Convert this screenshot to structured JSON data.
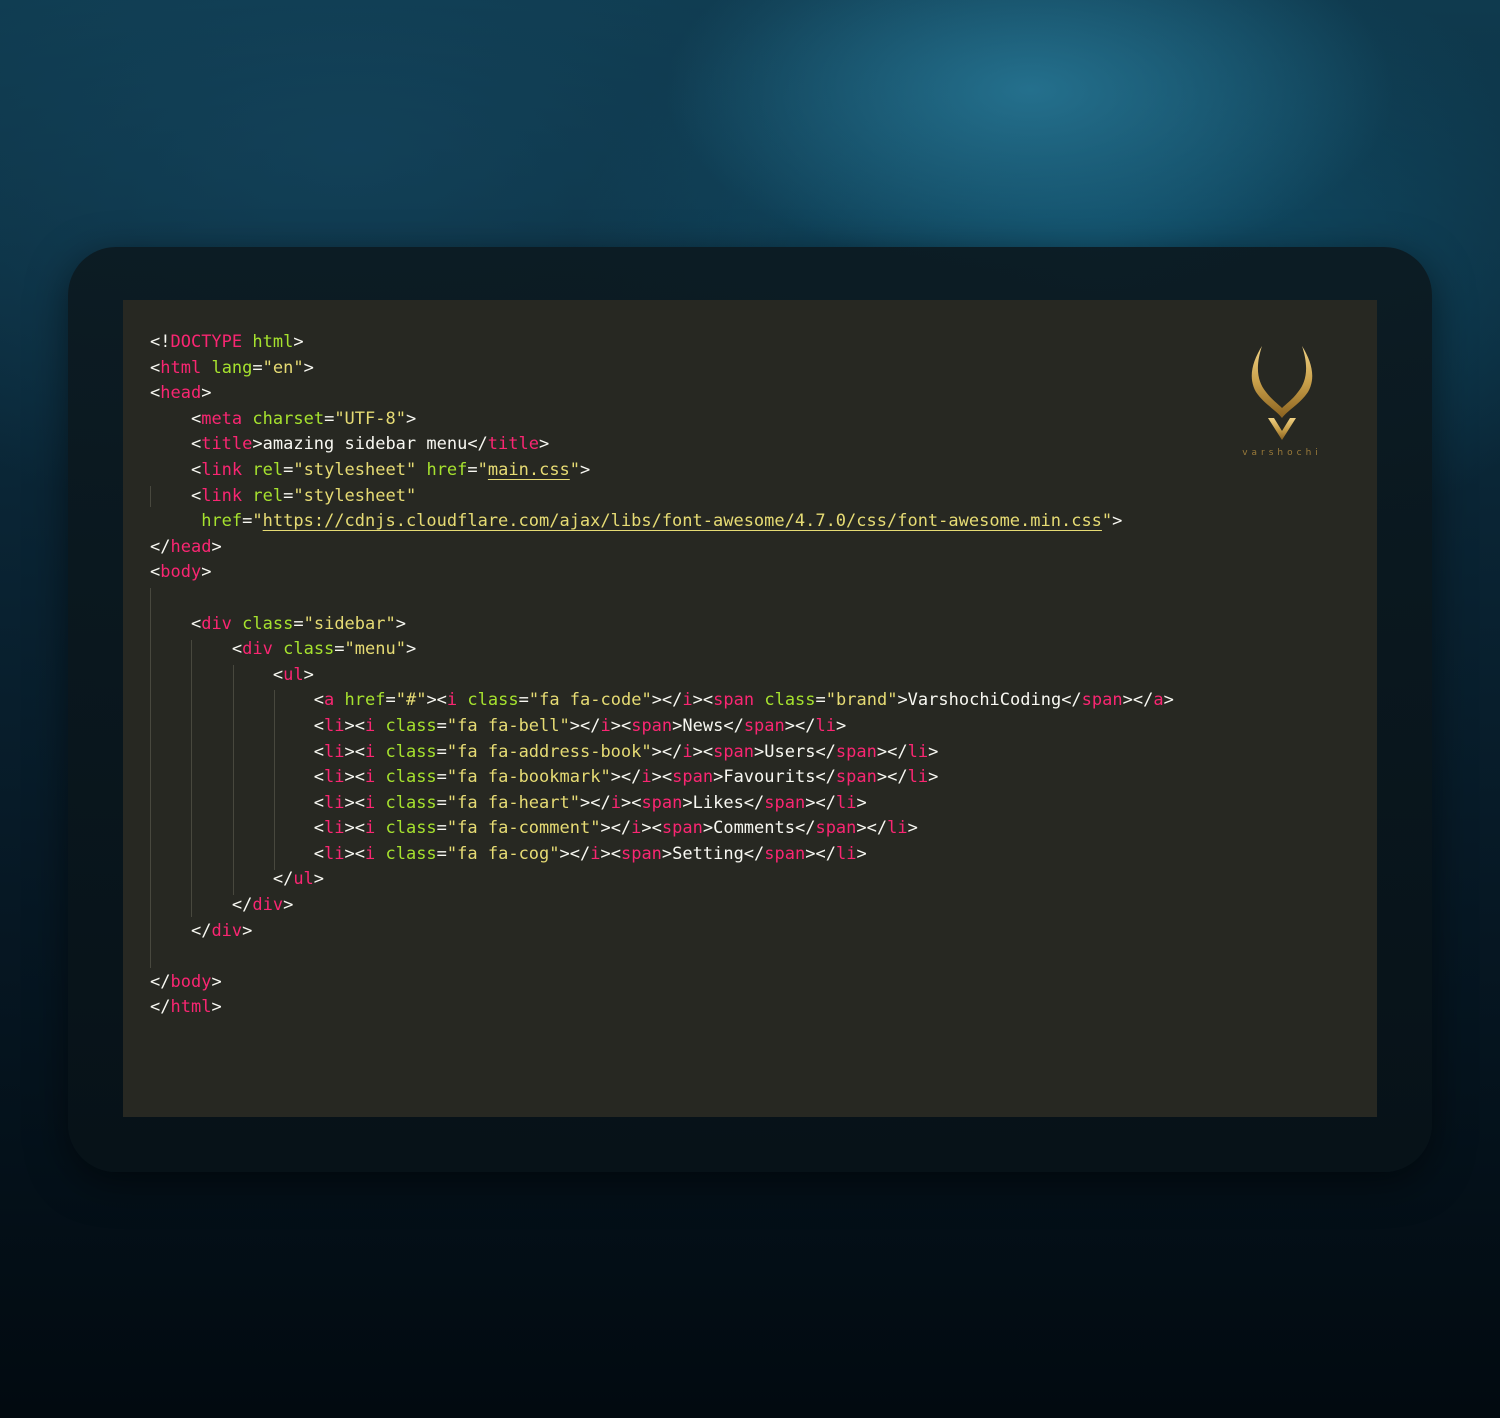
{
  "code": {
    "lines": [
      {
        "indent": 0,
        "segs": [
          [
            "p",
            "<!"
          ],
          [
            "t",
            "DOCTYPE"
          ],
          [
            "p",
            " "
          ],
          [
            "a",
            "html"
          ],
          [
            "p",
            ">"
          ]
        ]
      },
      {
        "indent": 0,
        "segs": [
          [
            "p",
            "<"
          ],
          [
            "t",
            "html"
          ],
          [
            "p",
            " "
          ],
          [
            "a",
            "lang"
          ],
          [
            "p",
            "="
          ],
          [
            "s",
            "\"en\""
          ],
          [
            "p",
            ">"
          ]
        ]
      },
      {
        "indent": 0,
        "segs": [
          [
            "p",
            "<"
          ],
          [
            "t",
            "head"
          ],
          [
            "p",
            ">"
          ]
        ]
      },
      {
        "indent": 1,
        "segs": [
          [
            "p",
            "<"
          ],
          [
            "t",
            "meta"
          ],
          [
            "p",
            " "
          ],
          [
            "a",
            "charset"
          ],
          [
            "p",
            "="
          ],
          [
            "s",
            "\"UTF-8\""
          ],
          [
            "p",
            ">"
          ]
        ]
      },
      {
        "indent": 1,
        "segs": [
          [
            "p",
            "<"
          ],
          [
            "t",
            "title"
          ],
          [
            "p",
            ">amazing sidebar menu</"
          ],
          [
            "t",
            "title"
          ],
          [
            "p",
            ">"
          ]
        ]
      },
      {
        "indent": 1,
        "segs": [
          [
            "p",
            "<"
          ],
          [
            "t",
            "link"
          ],
          [
            "p",
            " "
          ],
          [
            "a",
            "rel"
          ],
          [
            "p",
            "="
          ],
          [
            "s",
            "\"stylesheet\""
          ],
          [
            "p",
            " "
          ],
          [
            "a",
            "href"
          ],
          [
            "p",
            "="
          ],
          [
            "s",
            "\""
          ],
          [
            "su",
            "main.css"
          ],
          [
            "s",
            "\""
          ],
          [
            "p",
            ">"
          ]
        ]
      },
      {
        "indent": 1,
        "segs": [
          [
            "p",
            "<"
          ],
          [
            "t",
            "link"
          ],
          [
            "p",
            " "
          ],
          [
            "a",
            "rel"
          ],
          [
            "p",
            "="
          ],
          [
            "s",
            "\"stylesheet\""
          ]
        ]
      },
      {
        "indent": 1,
        "wrap": true,
        "segs": [
          [
            "p",
            " "
          ],
          [
            "a",
            "href"
          ],
          [
            "p",
            "="
          ],
          [
            "s",
            "\""
          ],
          [
            "su",
            "https://cdnjs.cloudflare.com/ajax/libs/font-awesome/4.7.0/css/font-awesome.min.css"
          ],
          [
            "s",
            "\""
          ],
          [
            "p",
            ">"
          ]
        ]
      },
      {
        "indent": 0,
        "segs": [
          [
            "p",
            "</"
          ],
          [
            "t",
            "head"
          ],
          [
            "p",
            ">"
          ]
        ]
      },
      {
        "indent": 0,
        "segs": [
          [
            "p",
            "<"
          ],
          [
            "t",
            "body"
          ],
          [
            "p",
            ">"
          ]
        ]
      },
      {
        "indent": 0,
        "segs": []
      },
      {
        "indent": 1,
        "segs": [
          [
            "p",
            "<"
          ],
          [
            "t",
            "div"
          ],
          [
            "p",
            " "
          ],
          [
            "a",
            "class"
          ],
          [
            "p",
            "="
          ],
          [
            "s",
            "\"sidebar\""
          ],
          [
            "p",
            ">"
          ]
        ]
      },
      {
        "indent": 2,
        "segs": [
          [
            "p",
            "<"
          ],
          [
            "t",
            "div"
          ],
          [
            "p",
            " "
          ],
          [
            "a",
            "class"
          ],
          [
            "p",
            "="
          ],
          [
            "s",
            "\"menu\""
          ],
          [
            "p",
            ">"
          ]
        ]
      },
      {
        "indent": 3,
        "segs": [
          [
            "p",
            "<"
          ],
          [
            "t",
            "ul"
          ],
          [
            "p",
            ">"
          ]
        ]
      },
      {
        "indent": 4,
        "segs": [
          [
            "p",
            "<"
          ],
          [
            "t",
            "a"
          ],
          [
            "p",
            " "
          ],
          [
            "a",
            "href"
          ],
          [
            "p",
            "="
          ],
          [
            "s",
            "\"#\""
          ],
          [
            "p",
            "><"
          ],
          [
            "t",
            "i"
          ],
          [
            "p",
            " "
          ],
          [
            "a",
            "class"
          ],
          [
            "p",
            "="
          ],
          [
            "s",
            "\"fa fa-code\""
          ],
          [
            "p",
            "></"
          ],
          [
            "t",
            "i"
          ],
          [
            "p",
            "><"
          ],
          [
            "t",
            "span"
          ],
          [
            "p",
            " "
          ],
          [
            "a",
            "class"
          ],
          [
            "p",
            "="
          ],
          [
            "s",
            "\"brand\""
          ],
          [
            "p",
            ">VarshochiCoding</"
          ],
          [
            "t",
            "span"
          ],
          [
            "p",
            "></"
          ],
          [
            "t",
            "a"
          ],
          [
            "p",
            ">"
          ]
        ]
      },
      {
        "indent": 4,
        "segs": [
          [
            "p",
            "<"
          ],
          [
            "t",
            "li"
          ],
          [
            "p",
            "><"
          ],
          [
            "t",
            "i"
          ],
          [
            "p",
            " "
          ],
          [
            "a",
            "class"
          ],
          [
            "p",
            "="
          ],
          [
            "s",
            "\"fa fa-bell\""
          ],
          [
            "p",
            "></"
          ],
          [
            "t",
            "i"
          ],
          [
            "p",
            "><"
          ],
          [
            "t",
            "span"
          ],
          [
            "p",
            ">News</"
          ],
          [
            "t",
            "span"
          ],
          [
            "p",
            "></"
          ],
          [
            "t",
            "li"
          ],
          [
            "p",
            ">"
          ]
        ]
      },
      {
        "indent": 4,
        "segs": [
          [
            "p",
            "<"
          ],
          [
            "t",
            "li"
          ],
          [
            "p",
            "><"
          ],
          [
            "t",
            "i"
          ],
          [
            "p",
            " "
          ],
          [
            "a",
            "class"
          ],
          [
            "p",
            "="
          ],
          [
            "s",
            "\"fa fa-address-book\""
          ],
          [
            "p",
            "></"
          ],
          [
            "t",
            "i"
          ],
          [
            "p",
            "><"
          ],
          [
            "t",
            "span"
          ],
          [
            "p",
            ">Users</"
          ],
          [
            "t",
            "span"
          ],
          [
            "p",
            "></"
          ],
          [
            "t",
            "li"
          ],
          [
            "p",
            ">"
          ]
        ]
      },
      {
        "indent": 4,
        "segs": [
          [
            "p",
            "<"
          ],
          [
            "t",
            "li"
          ],
          [
            "p",
            "><"
          ],
          [
            "t",
            "i"
          ],
          [
            "p",
            " "
          ],
          [
            "a",
            "class"
          ],
          [
            "p",
            "="
          ],
          [
            "s",
            "\"fa fa-bookmark\""
          ],
          [
            "p",
            "></"
          ],
          [
            "t",
            "i"
          ],
          [
            "p",
            "><"
          ],
          [
            "t",
            "span"
          ],
          [
            "p",
            ">Favourits</"
          ],
          [
            "t",
            "span"
          ],
          [
            "p",
            "></"
          ],
          [
            "t",
            "li"
          ],
          [
            "p",
            ">"
          ]
        ]
      },
      {
        "indent": 4,
        "segs": [
          [
            "p",
            "<"
          ],
          [
            "t",
            "li"
          ],
          [
            "p",
            "><"
          ],
          [
            "t",
            "i"
          ],
          [
            "p",
            " "
          ],
          [
            "a",
            "class"
          ],
          [
            "p",
            "="
          ],
          [
            "s",
            "\"fa fa-heart\""
          ],
          [
            "p",
            "></"
          ],
          [
            "t",
            "i"
          ],
          [
            "p",
            "><"
          ],
          [
            "t",
            "span"
          ],
          [
            "p",
            ">Likes</"
          ],
          [
            "t",
            "span"
          ],
          [
            "p",
            "></"
          ],
          [
            "t",
            "li"
          ],
          [
            "p",
            ">"
          ]
        ]
      },
      {
        "indent": 4,
        "segs": [
          [
            "p",
            "<"
          ],
          [
            "t",
            "li"
          ],
          [
            "p",
            "><"
          ],
          [
            "t",
            "i"
          ],
          [
            "p",
            " "
          ],
          [
            "a",
            "class"
          ],
          [
            "p",
            "="
          ],
          [
            "s",
            "\"fa fa-comment\""
          ],
          [
            "p",
            "></"
          ],
          [
            "t",
            "i"
          ],
          [
            "p",
            "><"
          ],
          [
            "t",
            "span"
          ],
          [
            "p",
            ">Comments</"
          ],
          [
            "t",
            "span"
          ],
          [
            "p",
            "></"
          ],
          [
            "t",
            "li"
          ],
          [
            "p",
            ">"
          ]
        ]
      },
      {
        "indent": 4,
        "segs": [
          [
            "p",
            "<"
          ],
          [
            "t",
            "li"
          ],
          [
            "p",
            "><"
          ],
          [
            "t",
            "i"
          ],
          [
            "p",
            " "
          ],
          [
            "a",
            "class"
          ],
          [
            "p",
            "="
          ],
          [
            "s",
            "\"fa fa-cog\""
          ],
          [
            "p",
            "></"
          ],
          [
            "t",
            "i"
          ],
          [
            "p",
            "><"
          ],
          [
            "t",
            "span"
          ],
          [
            "p",
            ">Setting</"
          ],
          [
            "t",
            "span"
          ],
          [
            "p",
            "></"
          ],
          [
            "t",
            "li"
          ],
          [
            "p",
            ">"
          ]
        ]
      },
      {
        "indent": 3,
        "segs": [
          [
            "p",
            "</"
          ],
          [
            "t",
            "ul"
          ],
          [
            "p",
            ">"
          ]
        ]
      },
      {
        "indent": 2,
        "segs": [
          [
            "p",
            "</"
          ],
          [
            "t",
            "div"
          ],
          [
            "p",
            ">"
          ]
        ]
      },
      {
        "indent": 1,
        "segs": [
          [
            "p",
            "</"
          ],
          [
            "t",
            "div"
          ],
          [
            "p",
            ">"
          ]
        ]
      },
      {
        "indent": 0,
        "segs": []
      },
      {
        "indent": 0,
        "segs": [
          [
            "p",
            "</"
          ],
          [
            "t",
            "body"
          ],
          [
            "p",
            ">"
          ]
        ]
      },
      {
        "indent": 0,
        "segs": [
          [
            "p",
            "</"
          ],
          [
            "t",
            "html"
          ],
          [
            "p",
            ">"
          ]
        ]
      }
    ]
  },
  "logo": {
    "icon": "horned-v-logo-icon",
    "text": "varshochi",
    "color": "#c9a04a"
  },
  "colors": {
    "editor_bg": "#272822",
    "tag": "#f92672",
    "attr": "#a6e22e",
    "string": "#e6db74",
    "plain": "#f8f8f2"
  }
}
